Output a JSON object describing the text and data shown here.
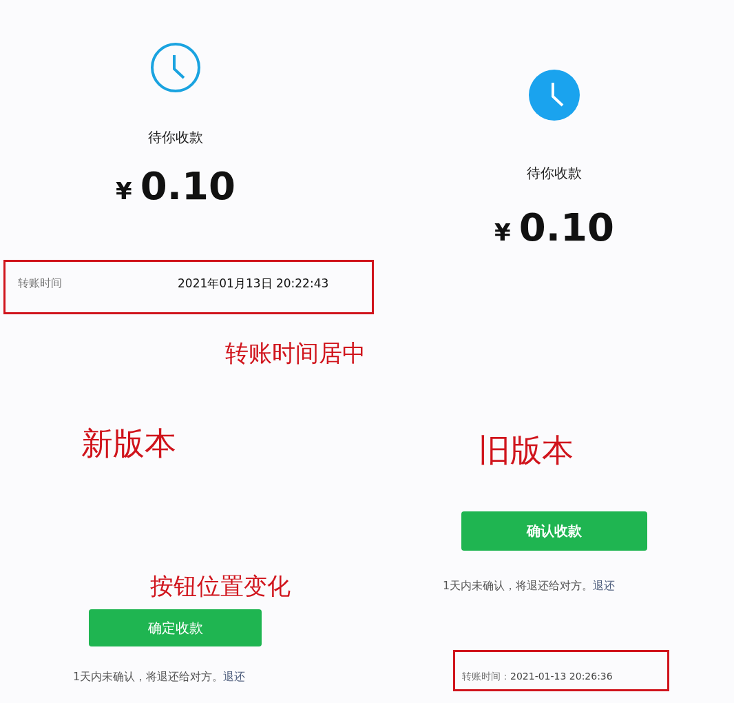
{
  "new_version": {
    "kind": "outline",
    "status": "待你收款",
    "currency": "¥",
    "amount": "0.10",
    "transfer_time": {
      "label": "转账时间",
      "value": "2021年01月13日 20:22:43",
      "highlighted": true
    },
    "annotation_time": "转账时间居中",
    "version_label": "新版本",
    "annotation_button": "按钮位置变化",
    "button": "确定收款",
    "note": "1天内未确认，将退还给对方。",
    "note_link": "退还"
  },
  "old_version": {
    "kind": "filled",
    "status": "待你收款",
    "currency": "¥",
    "amount": "0.10",
    "version_label": "旧版本",
    "button": "确认收款",
    "note": "1天内未确认，将退还给对方。",
    "note_link": "退还",
    "transfer_time": {
      "label": "转账时间：",
      "value": "2021-01-13 20:26:36",
      "highlighted": true
    }
  }
}
